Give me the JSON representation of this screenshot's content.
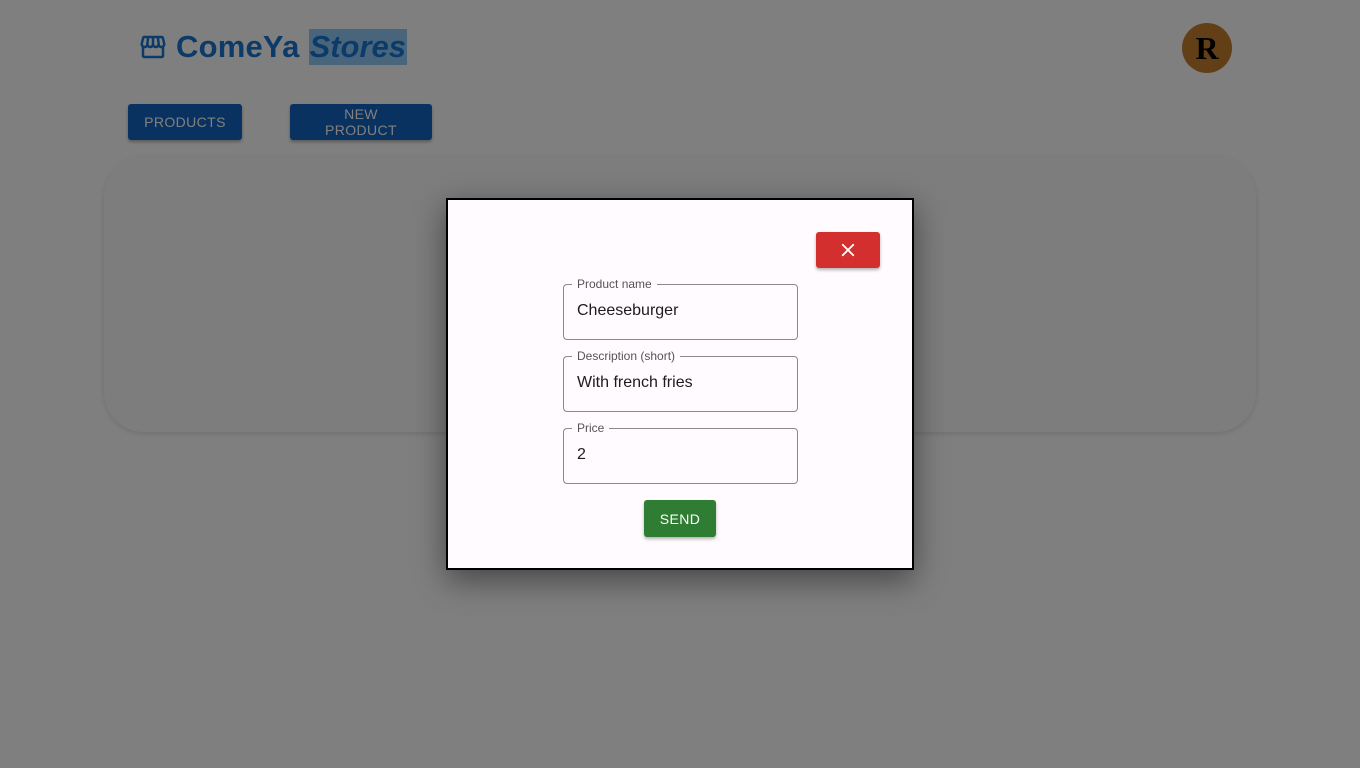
{
  "header": {
    "brand_main": "ComeYa",
    "brand_sub": "Stores",
    "brand_icon": "storefront-icon",
    "avatar_initial": "R"
  },
  "nav": {
    "products_label": "Products",
    "new_product_label": "New product"
  },
  "modal": {
    "close_icon": "close-icon",
    "fields": {
      "product_name": {
        "label": "Product name",
        "value": "Cheeseburger"
      },
      "description": {
        "label": "Description (short)",
        "value": "With french fries"
      },
      "price": {
        "label": "Price",
        "value": "2"
      }
    },
    "send_label": "Send"
  },
  "colors": {
    "primary": "#1976d2",
    "nav_button": "#1565c0",
    "close_button": "#d32f2f",
    "send_button": "#2e7d32",
    "avatar": "#c77e2e",
    "overlay": "rgba(0,0,0,0.5)"
  }
}
